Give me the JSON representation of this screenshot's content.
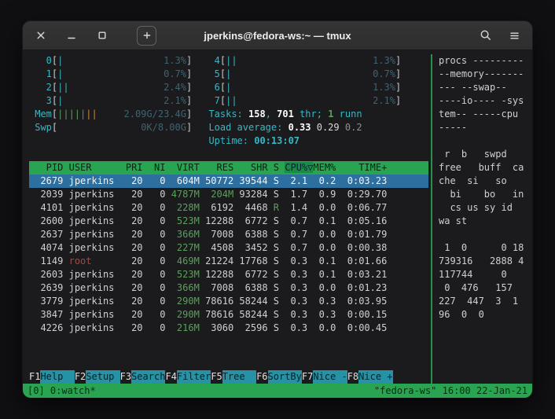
{
  "window": {
    "title": "jperkins@fedora-ws:~ — tmux"
  },
  "colors": {
    "terminal_bg": "#1b1b1e",
    "titlebar_bg": "#2e2e2e",
    "text": "#d0d0d0",
    "accent_green": "#29a552",
    "selection_blue": "#2d6f9f",
    "cyan": "#38b7c4",
    "fn_teal": "#2592a5",
    "value_green": "#5aa05a",
    "meter_shadow": "#3f6370",
    "other_user_red": "#a04b4b",
    "bar_orange": "#c8883a",
    "bar_blue": "#5a7bc8"
  },
  "htop": {
    "cpu_meters": [
      {
        "label": "0",
        "ticks": [
          [
            "cyan",
            1
          ]
        ],
        "value": "1.3%"
      },
      {
        "label": "1",
        "ticks": [
          [
            "cyan",
            1
          ]
        ],
        "value": "0.7%"
      },
      {
        "label": "2",
        "ticks": [
          [
            "cyan",
            2
          ]
        ],
        "value": "2.4%"
      },
      {
        "label": "3",
        "ticks": [
          [
            "cyan",
            1
          ]
        ],
        "value": "2.1%"
      },
      {
        "label": "4",
        "ticks": [
          [
            "cyan",
            2
          ]
        ],
        "value": "1.3%"
      },
      {
        "label": "5",
        "ticks": [
          [
            "cyan",
            1
          ]
        ],
        "value": "0.7%"
      },
      {
        "label": "6",
        "ticks": [
          [
            "cyan",
            1
          ]
        ],
        "value": "1.3%"
      },
      {
        "label": "7",
        "ticks": [
          [
            "cyan",
            2
          ]
        ],
        "value": "2.1%"
      }
    ],
    "mem_meter": {
      "label": "Mem",
      "ticks": [
        [
          "green",
          4
        ],
        [
          "blue",
          1
        ],
        [
          "orange",
          2
        ]
      ],
      "value": "2.09G/23.4G"
    },
    "swp_meter": {
      "label": "Swp",
      "ticks": [],
      "value": "0K/8.00G"
    },
    "tasks_line": [
      [
        "Tasks: ",
        "lbl"
      ],
      [
        "158",
        "bold"
      ],
      [
        ", ",
        "lbl"
      ],
      [
        "701",
        "bold"
      ],
      [
        " thr; ",
        "lbl"
      ],
      [
        "1",
        "grn"
      ],
      [
        " runn",
        "lbl"
      ]
    ],
    "load_line": [
      [
        "Load average: ",
        "lbl"
      ],
      [
        "0.33",
        "bold"
      ],
      [
        " ",
        "plain"
      ],
      [
        "0.29",
        "plain"
      ],
      [
        " ",
        "plain"
      ],
      [
        "0.2",
        "dim"
      ]
    ],
    "uptime_line": [
      [
        "Uptime: ",
        "lbl"
      ],
      [
        "00:13:07",
        "cyb"
      ]
    ],
    "table": {
      "headers": [
        "PID",
        "USER",
        "PRI",
        "NI",
        "VIRT",
        "RES",
        "SHR",
        "S",
        "CPU%▽",
        "MEM%",
        "TIME+"
      ],
      "rows": [
        {
          "pid": "2679",
          "user": "jperkins",
          "pri": "20",
          "ni": "0",
          "virt": "604M",
          "res": "50772",
          "shr": "39544",
          "s": "S",
          "cpu": "2.1",
          "mem": "0.2",
          "time": "0:03.23",
          "selected": true
        },
        {
          "pid": "2039",
          "user": "jperkins",
          "pri": "20",
          "ni": "0",
          "virt": "4787M",
          "res": "204M",
          "shr": "93284",
          "s": "S",
          "cpu": "1.7",
          "mem": "0.9",
          "time": "0:29.70"
        },
        {
          "pid": "4101",
          "user": "jperkins",
          "pri": "20",
          "ni": "0",
          "virt": "228M",
          "res": "6192",
          "shr": "4468",
          "s": "R",
          "cpu": "1.4",
          "mem": "0.0",
          "time": "0:06.77"
        },
        {
          "pid": "2600",
          "user": "jperkins",
          "pri": "20",
          "ni": "0",
          "virt": "523M",
          "res": "12288",
          "shr": "6772",
          "s": "S",
          "cpu": "0.7",
          "mem": "0.1",
          "time": "0:05.16"
        },
        {
          "pid": "2637",
          "user": "jperkins",
          "pri": "20",
          "ni": "0",
          "virt": "366M",
          "res": "7008",
          "shr": "6388",
          "s": "S",
          "cpu": "0.7",
          "mem": "0.0",
          "time": "0:01.79"
        },
        {
          "pid": "4074",
          "user": "jperkins",
          "pri": "20",
          "ni": "0",
          "virt": "227M",
          "res": "4508",
          "shr": "3452",
          "s": "S",
          "cpu": "0.7",
          "mem": "0.0",
          "time": "0:00.38"
        },
        {
          "pid": "1149",
          "user": "root",
          "pri": "20",
          "ni": "0",
          "virt": "469M",
          "res": "21224",
          "shr": "17768",
          "s": "S",
          "cpu": "0.3",
          "mem": "0.1",
          "time": "0:01.66"
        },
        {
          "pid": "2603",
          "user": "jperkins",
          "pri": "20",
          "ni": "0",
          "virt": "523M",
          "res": "12288",
          "shr": "6772",
          "s": "S",
          "cpu": "0.3",
          "mem": "0.1",
          "time": "0:03.21"
        },
        {
          "pid": "2639",
          "user": "jperkins",
          "pri": "20",
          "ni": "0",
          "virt": "366M",
          "res": "7008",
          "shr": "6388",
          "s": "S",
          "cpu": "0.3",
          "mem": "0.0",
          "time": "0:01.23"
        },
        {
          "pid": "3779",
          "user": "jperkins",
          "pri": "20",
          "ni": "0",
          "virt": "290M",
          "res": "78616",
          "shr": "58244",
          "s": "S",
          "cpu": "0.3",
          "mem": "0.3",
          "time": "0:03.95"
        },
        {
          "pid": "3847",
          "user": "jperkins",
          "pri": "20",
          "ni": "0",
          "virt": "290M",
          "res": "78616",
          "shr": "58244",
          "s": "S",
          "cpu": "0.3",
          "mem": "0.3",
          "time": "0:00.15"
        },
        {
          "pid": "4226",
          "user": "jperkins",
          "pri": "20",
          "ni": "0",
          "virt": "216M",
          "res": "3060",
          "shr": "2596",
          "s": "S",
          "cpu": "0.3",
          "mem": "0.0",
          "time": "0:00.45"
        }
      ]
    },
    "fnkeys": [
      {
        "key": "F1",
        "label": "Help"
      },
      {
        "key": "F2",
        "label": "Setup"
      },
      {
        "key": "F3",
        "label": "Search"
      },
      {
        "key": "F4",
        "label": "Filter"
      },
      {
        "key": "F5",
        "label": "Tree"
      },
      {
        "key": "F6",
        "label": "SortBy"
      },
      {
        "key": "F7",
        "label": "Nice -"
      },
      {
        "key": "F8",
        "label": "Nice +"
      }
    ]
  },
  "vmstat_pane": {
    "lines": [
      "procs ---------",
      "--memory-------",
      "--- --swap--",
      "----io---- -sys",
      "tem-- -----cpu",
      "-----",
      "",
      " r  b   swpd",
      "free   buff  ca",
      "che  si   so",
      "  bi    bo   in",
      "  cs us sy id",
      "wa st",
      "",
      " 1  0      0 18",
      "739316   2888 4",
      "117744     0",
      " 0  476   157",
      "227  447  3  1",
      "96  0  0"
    ]
  },
  "tmux_bar": {
    "left": "[0] 0:watch*",
    "right": "\"fedora-ws\" 16:00 22-Jan-21"
  }
}
